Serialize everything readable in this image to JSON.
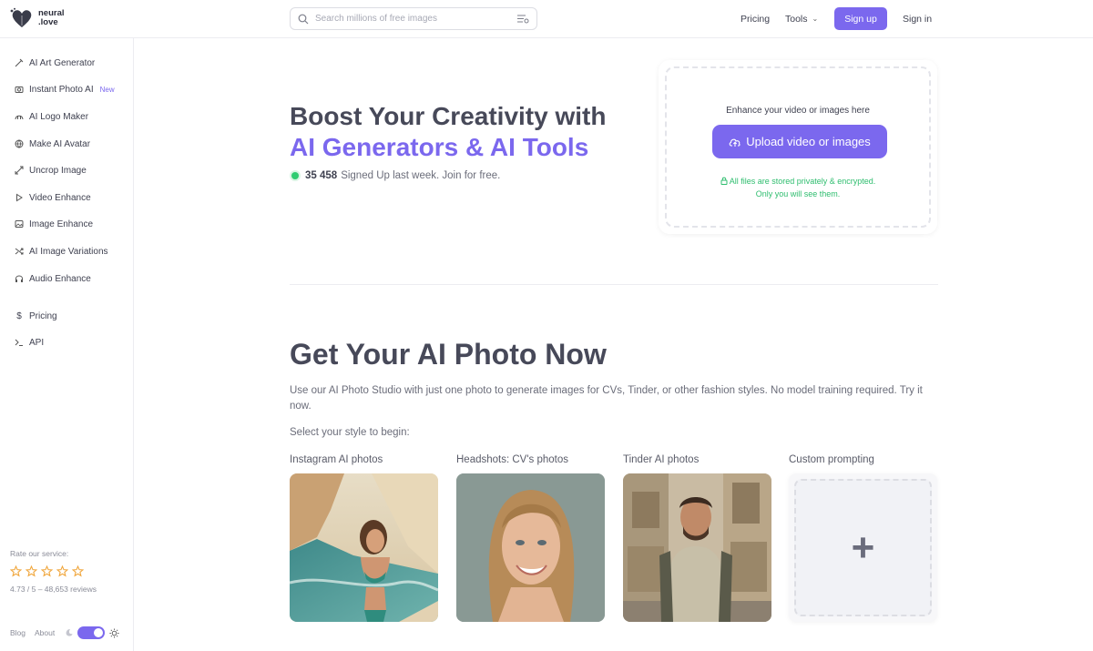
{
  "header": {
    "logo_text_line1": "neural",
    "logo_text_line2": ".love",
    "search_placeholder": "Search millions of free images",
    "nav_pricing": "Pricing",
    "nav_tools": "Tools",
    "signup_label": "Sign up",
    "signin_label": "Sign in"
  },
  "sidebar": {
    "items": [
      {
        "label": "AI Art Generator",
        "icon": "brush-icon"
      },
      {
        "label": "Instant Photo AI",
        "icon": "camera-icon",
        "badge": "New"
      },
      {
        "label": "AI Logo Maker",
        "icon": "logo-icon"
      },
      {
        "label": "Make AI Avatar",
        "icon": "globe-icon"
      },
      {
        "label": "Uncrop Image",
        "icon": "expand-icon"
      },
      {
        "label": "Video Enhance",
        "icon": "play-icon"
      },
      {
        "label": "Image Enhance",
        "icon": "image-icon"
      },
      {
        "label": "AI Image Variations",
        "icon": "shuffle-icon"
      },
      {
        "label": "Audio Enhance",
        "icon": "headphones-icon"
      },
      {
        "label": "Pricing",
        "icon": "dollar-icon"
      },
      {
        "label": "API",
        "icon": "terminal-icon"
      }
    ],
    "rate_label": "Rate our service:",
    "stars": 5,
    "rating_text": "4.73 / 5 – 48,653 reviews",
    "footer_blog": "Blog",
    "footer_about": "About"
  },
  "hero": {
    "title_line1": "Boost Your Creativity with",
    "title_line2": "AI Generators & AI Tools",
    "signup_count": "35 458",
    "signup_text": "Signed Up last week. Join for free."
  },
  "upload": {
    "label": "Enhance your video or images here",
    "button": "Upload video or images",
    "note_line1": "All files are stored privately & encrypted.",
    "note_line2": "Only you will see them."
  },
  "photo_section": {
    "title": "Get Your AI Photo Now",
    "description": "Use our AI Photo Studio with just one photo to generate images for CVs, Tinder, or other fashion styles. No model training required. Try it now.",
    "select_prompt": "Select your style to begin:",
    "cards": [
      {
        "label": "Instagram AI photos"
      },
      {
        "label": "Headshots: CV's photos"
      },
      {
        "label": "Tinder AI photos"
      },
      {
        "label": "Custom prompting"
      }
    ]
  },
  "colors": {
    "accent": "#7b68ee",
    "success": "#2ebd6e",
    "star": "#f0a53a"
  }
}
